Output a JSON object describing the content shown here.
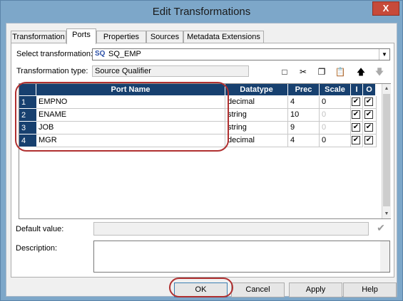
{
  "window": {
    "title": "Edit Transformations",
    "close_glyph": "X"
  },
  "tabs": [
    "Transformation",
    "Ports",
    "Properties",
    "Sources",
    "Metadata Extensions"
  ],
  "select_transformation": {
    "label": "Select transformation:",
    "badge": "SQ",
    "value": "SQ_EMP",
    "dropdown_glyph": "▼"
  },
  "transformation_type": {
    "label": "Transformation type:",
    "value": "Source Qualifier"
  },
  "toolbar_icons": [
    {
      "name": "new-port-icon",
      "glyph": "□"
    },
    {
      "name": "cut-icon",
      "glyph": "✂"
    },
    {
      "name": "copy-icon",
      "glyph": "❐"
    },
    {
      "name": "paste-icon",
      "glyph": "📋"
    },
    {
      "name": "move-up-icon",
      "glyph": "🡅"
    },
    {
      "name": "move-down-icon",
      "glyph": "🡇"
    }
  ],
  "grid": {
    "headers": [
      "Port Name",
      "Datatype",
      "Prec",
      "Scale",
      "I",
      "O"
    ],
    "rows": [
      {
        "num": "1",
        "port": "EMPNO",
        "datatype": "decimal",
        "prec": "4",
        "scale": "0",
        "scale_dim": false,
        "i": true,
        "o": true
      },
      {
        "num": "2",
        "port": "ENAME",
        "datatype": "string",
        "prec": "10",
        "scale": "0",
        "scale_dim": true,
        "i": true,
        "o": true
      },
      {
        "num": "3",
        "port": "JOB",
        "datatype": "string",
        "prec": "9",
        "scale": "0",
        "scale_dim": true,
        "i": true,
        "o": true
      },
      {
        "num": "4",
        "port": "MGR",
        "datatype": "decimal",
        "prec": "4",
        "scale": "0",
        "scale_dim": false,
        "i": true,
        "o": true
      }
    ]
  },
  "default_value": {
    "label": "Default value:",
    "value": ""
  },
  "description": {
    "label": "Description:",
    "value": ""
  },
  "buttons": {
    "ok": "OK",
    "cancel": "Cancel",
    "apply": "Apply",
    "help": "Help"
  }
}
